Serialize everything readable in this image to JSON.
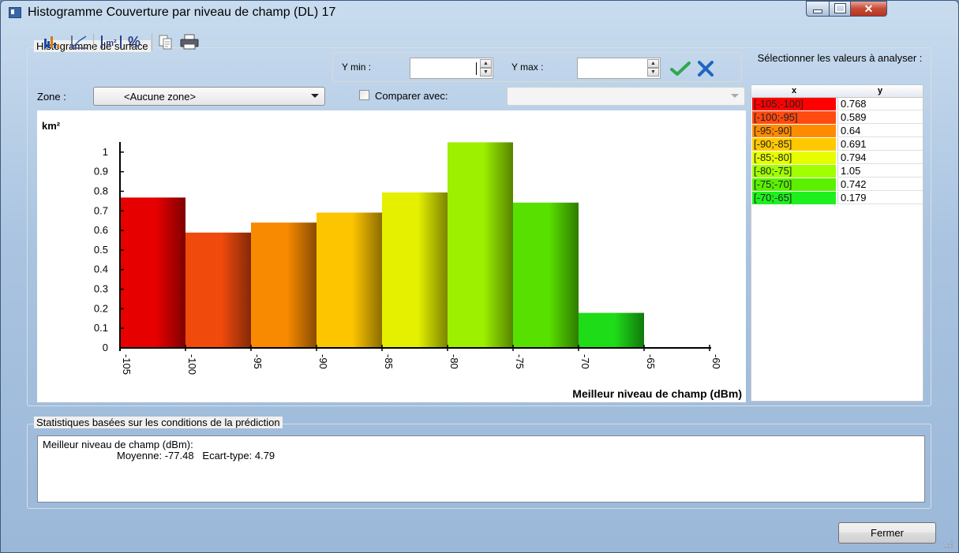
{
  "window": {
    "title": "Histogramme   Couverture par niveau de champ (DL) 17"
  },
  "toolbar": {
    "icons": [
      "bar-chart-icon",
      "line-chart-icon",
      "area-unit-icon",
      "percent-icon",
      "copy-icon",
      "print-icon"
    ],
    "percent_label": "%"
  },
  "histogram_group": {
    "title": "Histogramme de surface"
  },
  "range": {
    "ymin_label": "Y min :",
    "ymin_value": "",
    "ymax_label": "Y max :",
    "ymax_value": "",
    "apply_color": "#2ea84a",
    "cancel_color": "#1f66c1"
  },
  "zone": {
    "label": "Zone :",
    "selected": "<Aucune zone>",
    "compare_label": "Comparer avec:",
    "compare_checked": false,
    "compare_selected": ""
  },
  "chart_data": {
    "type": "bar",
    "ylabel": "km²",
    "xlabel": "Meilleur niveau de champ (dBm)",
    "ylim": [
      0,
      1.1
    ],
    "yticks": [
      "0",
      "0.1",
      "0.2",
      "0.3",
      "0.4",
      "0.5",
      "0.6",
      "0.7",
      "0.8",
      "0.9",
      "1"
    ],
    "xticks": [
      "-105",
      "-100",
      "-95",
      "-90",
      "-85",
      "-80",
      "-75",
      "-70",
      "-65",
      "-60"
    ],
    "xlim": [
      -105,
      -60
    ],
    "bins": [
      {
        "from": -105,
        "to": -100,
        "value": 0.768,
        "color": "#e60000"
      },
      {
        "from": -100,
        "to": -95,
        "value": 0.589,
        "color": "#f04a0c"
      },
      {
        "from": -95,
        "to": -90,
        "value": 0.64,
        "color": "#f78a00"
      },
      {
        "from": -90,
        "to": -85,
        "value": 0.691,
        "color": "#fcc500"
      },
      {
        "from": -85,
        "to": -80,
        "value": 0.794,
        "color": "#e4f000"
      },
      {
        "from": -80,
        "to": -75,
        "value": 1.05,
        "color": "#9cf000"
      },
      {
        "from": -75,
        "to": -70,
        "value": 0.742,
        "color": "#57e000"
      },
      {
        "from": -70,
        "to": -65,
        "value": 0.179,
        "color": "#1fdc18"
      }
    ]
  },
  "table": {
    "title": "Sélectionner les valeurs à analyser :",
    "col_x": "x",
    "col_y": "y",
    "rows": [
      {
        "x": "[-105;-100]",
        "y": "0.768",
        "color": "#ff0000"
      },
      {
        "x": "[-100;-95]",
        "y": "0.589",
        "color": "#ff4a10"
      },
      {
        "x": "[-95;-90]",
        "y": "0.64",
        "color": "#ff8c00"
      },
      {
        "x": "[-90;-85]",
        "y": "0.691",
        "color": "#ffc800"
      },
      {
        "x": "[-85;-80]",
        "y": "0.794",
        "color": "#e6ff00"
      },
      {
        "x": "[-80;-75]",
        "y": "1.05",
        "color": "#a0ff00"
      },
      {
        "x": "[-75;-70]",
        "y": "0.742",
        "color": "#5af000"
      },
      {
        "x": "[-70;-65]",
        "y": "0.179",
        "color": "#1ef01e"
      }
    ]
  },
  "stats": {
    "title": "Statistiques basées sur les conditions de la prédiction",
    "line1": "Meilleur niveau de champ (dBm):",
    "line2": "Moyenne: -77.48   Ecart-type: 4.79"
  },
  "footer": {
    "close_label": "Fermer"
  }
}
